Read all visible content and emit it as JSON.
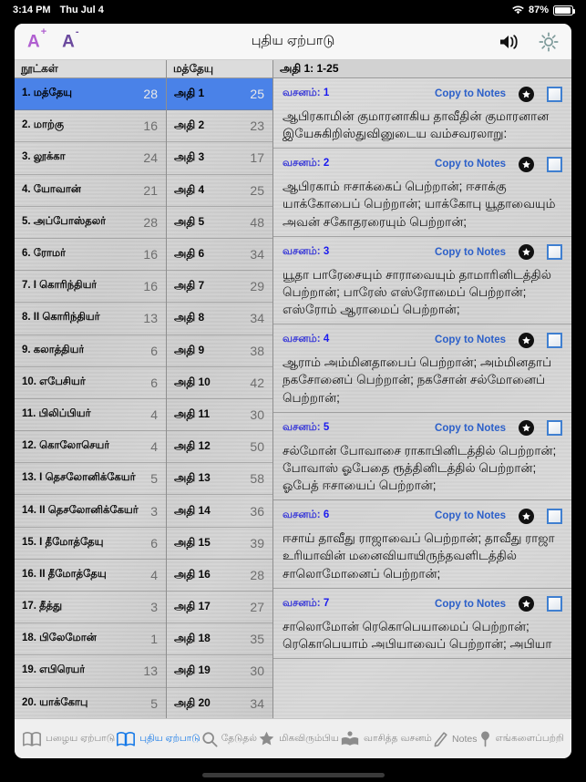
{
  "statusbar": {
    "time": "3:14 PM",
    "date": "Thu Jul 4",
    "battery_percent": "87%",
    "wifi_icon": "wifi-icon",
    "battery_icon": "battery-icon"
  },
  "header": {
    "title": "புதிய ஏற்பாடு",
    "font_increase_label": "A",
    "font_increase_sup": "+",
    "font_decrease_label": "A",
    "font_decrease_sup": "-",
    "speaker_icon": "speaker-icon",
    "brightness_icon": "brightness-icon",
    "accent_purple": "#b05fd0",
    "accent_violet": "#6b4a9e"
  },
  "books_panel": {
    "header": "நூட்கள்",
    "items": [
      {
        "label": "1. மத்தேயு",
        "count": "28",
        "selected": true
      },
      {
        "label": "2. மாற்கு",
        "count": "16",
        "selected": false
      },
      {
        "label": "3. லூக்கா",
        "count": "24",
        "selected": false
      },
      {
        "label": "4. யோவான்",
        "count": "21",
        "selected": false
      },
      {
        "label": "5. அப்போஸ்தலர்",
        "count": "28",
        "selected": false
      },
      {
        "label": "6. ரோமர்",
        "count": "16",
        "selected": false
      },
      {
        "label": "7. I கொரிந்தியர்",
        "count": "16",
        "selected": false
      },
      {
        "label": "8. II கொரிந்தியர்",
        "count": "13",
        "selected": false
      },
      {
        "label": "9. கலாத்தியர்",
        "count": "6",
        "selected": false
      },
      {
        "label": "10. எபேசியர்",
        "count": "6",
        "selected": false
      },
      {
        "label": "11. பிலிப்பியர்",
        "count": "4",
        "selected": false
      },
      {
        "label": "12. கொலோசெயர்",
        "count": "4",
        "selected": false
      },
      {
        "label": "13. I தெசலோனிக்கேயர்",
        "count": "5",
        "selected": false
      },
      {
        "label": "14. II தெசலோனிக்கேயர்",
        "count": "3",
        "selected": false
      },
      {
        "label": "15. I தீமோத்தேயு",
        "count": "6",
        "selected": false
      },
      {
        "label": "16. II தீமோத்தேயு",
        "count": "4",
        "selected": false
      },
      {
        "label": "17. தீத்து",
        "count": "3",
        "selected": false
      },
      {
        "label": "18. பிலேமோன்",
        "count": "1",
        "selected": false
      },
      {
        "label": "19. எபிரெயர்",
        "count": "13",
        "selected": false
      },
      {
        "label": "20. யாக்கோபு",
        "count": "5",
        "selected": false
      }
    ]
  },
  "chapters_panel": {
    "header": "மத்தேயு",
    "items": [
      {
        "label": "அதி 1",
        "count": "25",
        "selected": true
      },
      {
        "label": "அதி 2",
        "count": "23",
        "selected": false
      },
      {
        "label": "அதி 3",
        "count": "17",
        "selected": false
      },
      {
        "label": "அதி 4",
        "count": "25",
        "selected": false
      },
      {
        "label": "அதி 5",
        "count": "48",
        "selected": false
      },
      {
        "label": "அதி 6",
        "count": "34",
        "selected": false
      },
      {
        "label": "அதி 7",
        "count": "29",
        "selected": false
      },
      {
        "label": "அதி 8",
        "count": "34",
        "selected": false
      },
      {
        "label": "அதி 9",
        "count": "38",
        "selected": false
      },
      {
        "label": "அதி 10",
        "count": "42",
        "selected": false
      },
      {
        "label": "அதி 11",
        "count": "30",
        "selected": false
      },
      {
        "label": "அதி 12",
        "count": "50",
        "selected": false
      },
      {
        "label": "அதி 13",
        "count": "58",
        "selected": false
      },
      {
        "label": "அதி 14",
        "count": "36",
        "selected": false
      },
      {
        "label": "அதி 15",
        "count": "39",
        "selected": false
      },
      {
        "label": "அதி 16",
        "count": "28",
        "selected": false
      },
      {
        "label": "அதி 17",
        "count": "27",
        "selected": false
      },
      {
        "label": "அதி 18",
        "count": "35",
        "selected": false
      },
      {
        "label": "அதி 19",
        "count": "30",
        "selected": false
      },
      {
        "label": "அதி 20",
        "count": "34",
        "selected": false
      }
    ]
  },
  "verses_panel": {
    "header": "அதி 1: 1-25",
    "verse_prefix": "வசனம்:",
    "copy_to_notes_label": "Copy to Notes",
    "star_icon": "star-icon",
    "checkbox_icon": "checkbox-icon",
    "items": [
      {
        "number": "1",
        "text": "ஆபிரகாமின் குமாரனாகிய தாவீதின் குமாரனான இயேசுகிறிஸ்துவினுடைய வம்சவரலாறு:"
      },
      {
        "number": "2",
        "text": "ஆபிரகாம் ஈசாக்கைப் பெற்றான்; ஈசாக்கு யாக்கோபைப் பெற்றான்; யாக்கோபு யூதாவையும் அவன் சகோதரரையும் பெற்றான்;"
      },
      {
        "number": "3",
        "text": "யூதா பாரேசையும் சாராவையும் தாமாரினிடத்தில் பெற்றான்; பாரேஸ் எஸ்ரோமைப் பெற்றான்; எஸ்ரோம் ஆராமைப் பெற்றான்;"
      },
      {
        "number": "4",
        "text": "ஆராம் அம்மினதாபைப் பெற்றான்; அம்மினதாப் நகசோனைப் பெற்றான்; நகசோன் சல்மோனைப் பெற்றான்;"
      },
      {
        "number": "5",
        "text": "சல்மோன் போவாசை ராகாபினிடத்தில் பெற்றான்; போவாஸ் ஓபேதை ரூத்தினிடத்தில் பெற்றான்; ஓபேத் ஈசாயைப் பெற்றான்;"
      },
      {
        "number": "6",
        "text": "ஈசாய் தாவீது ராஜாவைப் பெற்றான்; தாவீது ராஜா உரியாவின் மனைவியாயிருந்தவளிடத்தில் சாலொமோனைப் பெற்றான்;"
      },
      {
        "number": "7",
        "text": "சாலொமோன் ரெகொபெயாமைப் பெற்றான்; ரெகொபெயாம் அபியாவைப் பெற்றான்; அபியா"
      }
    ]
  },
  "tabbar": {
    "items": [
      {
        "label": "பழைய ஏற்பாடு",
        "icon": "open-book-icon",
        "active": false
      },
      {
        "label": "புதிய ஏற்பாடு",
        "icon": "open-book-icon",
        "active": true
      },
      {
        "label": "தேடுதல்",
        "icon": "search-icon",
        "active": false
      },
      {
        "label": "மிகவிரும்பிய",
        "icon": "star-icon",
        "active": false
      },
      {
        "label": "வாசித்த வசனம்",
        "icon": "reading-person-icon",
        "active": false
      },
      {
        "label": "Notes",
        "icon": "pencil-icon",
        "active": false
      },
      {
        "label": "எங்களைப்பற்றி",
        "icon": "pin-icon",
        "active": false
      }
    ],
    "active_color": "#1579e8",
    "inactive_color": "#8c8c8c"
  }
}
